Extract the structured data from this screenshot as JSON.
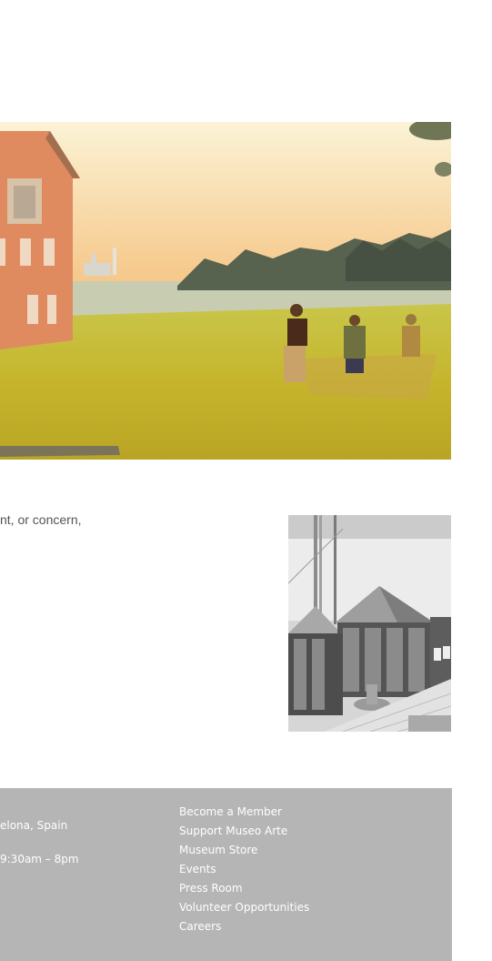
{
  "hero": {
    "image": "watercolor-landscape-painting"
  },
  "intro": {
    "text": "nt, or concern,"
  },
  "side_image": {
    "image": "architectural-pavilion-sketch"
  },
  "footer": {
    "address": "elona, Spain",
    "hours": "9:30am – 8pm",
    "links": [
      "Become a Member",
      "Support Museo Arte",
      "Museum Store",
      "Events",
      "Press Room",
      "Volunteer Opportunities",
      "Careers"
    ]
  }
}
